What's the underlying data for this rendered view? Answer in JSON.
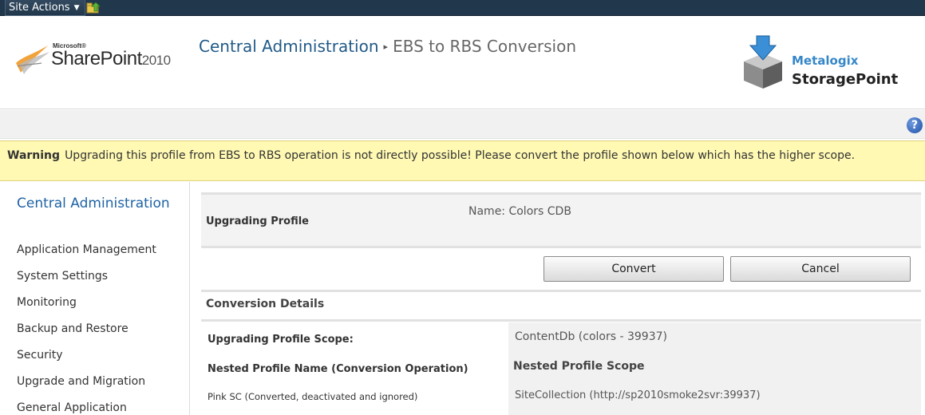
{
  "ribbon": {
    "site_actions": "Site Actions",
    "site_actions_caret": "▼"
  },
  "header": {
    "product_ms": "Microsoft®",
    "product_name": "SharePoint",
    "product_year": "2010",
    "breadcrumb_root": "Central Administration",
    "breadcrumb_sep": "▸",
    "breadcrumb_current": "EBS to RBS Conversion",
    "partner_brand": "Metalogix",
    "partner_product": "StoragePoint"
  },
  "help": {
    "icon": "?"
  },
  "warning": {
    "label": "Warning",
    "text": "Upgrading this profile from EBS to RBS operation is not directly possible! Please convert the profile shown below which has the higher scope."
  },
  "leftnav": {
    "title": "Central Administration",
    "items": [
      "Application Management",
      "System Settings",
      "Monitoring",
      "Backup and Restore",
      "Security",
      "Upgrade and Migration",
      "General Application"
    ]
  },
  "main": {
    "upgrading_label": "Upgrading Profile",
    "upgrading_value": "Name: Colors CDB",
    "convert_label": "Convert",
    "cancel_label": "Cancel",
    "details_heading": "Conversion Details",
    "scope_label": "Upgrading Profile Scope:",
    "scope_value": "ContentDb (colors - 39937)",
    "nested_name_label": "Nested Profile Name (Conversion Operation)",
    "nested_scope_label": "Nested Profile Scope",
    "nested_name_value": "Pink SC (Converted, deactivated and ignored)",
    "nested_scope_value": "SiteCollection (http://sp2010smoke2svr:39937)"
  },
  "colors": {
    "ribbon_bg": "#21374c",
    "link_blue": "#1e63a5",
    "warning_bg": "#fff9b3",
    "metalogix_blue": "#3587c8"
  }
}
